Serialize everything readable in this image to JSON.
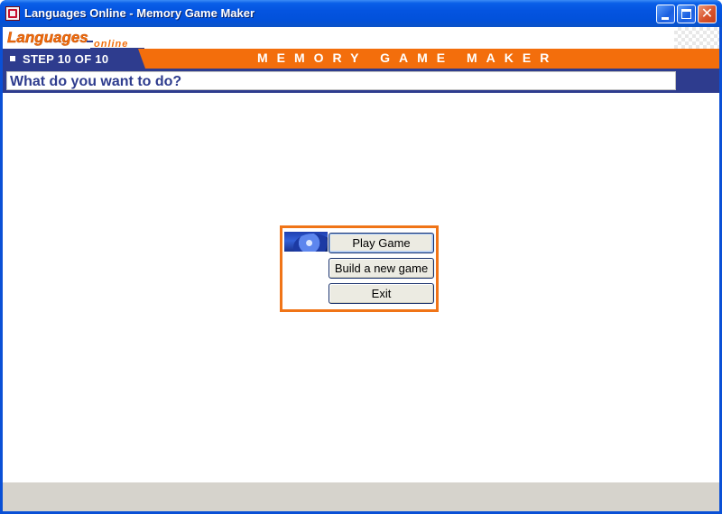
{
  "window": {
    "title": "Languages Online - Memory Game Maker",
    "controls": {
      "minimize": "minimize",
      "maximize": "maximize",
      "close": "close"
    }
  },
  "header": {
    "logo_text": "Languages",
    "logo_sub": "online",
    "step_label": "STEP 10 OF 10",
    "app_title": "MEMORY GAME MAKER"
  },
  "question": {
    "text": "What do you want to do?"
  },
  "menu": {
    "play_label": "Play Game",
    "build_label": "Build a new game",
    "exit_label": "Exit"
  },
  "colors": {
    "accent_orange": "#f36e0c",
    "navy": "#2e3c8e",
    "titlebar_blue": "#0454e0"
  }
}
